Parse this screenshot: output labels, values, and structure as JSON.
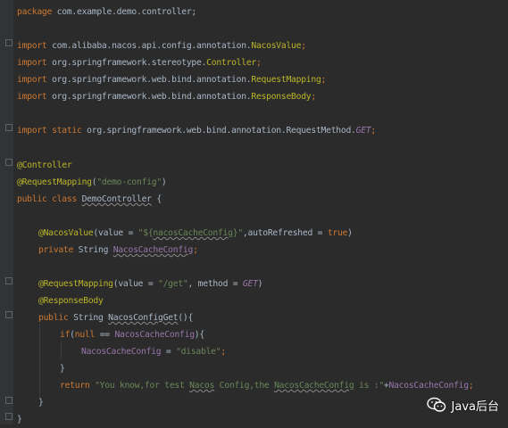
{
  "code": {
    "package_line": {
      "keyword": "package",
      "name": "com.example.demo.controller;"
    },
    "imports": [
      {
        "keyword": "import",
        "path": "com.alibaba.nacos.api.config.annotation.",
        "cls": "NacosValue",
        "end": ";"
      },
      {
        "keyword": "import",
        "path": "org.springframework.stereotype.",
        "cls": "Controller",
        "end": ";"
      },
      {
        "keyword": "import",
        "path": "org.springframework.web.bind.annotation.",
        "cls": "RequestMapping",
        "end": ";"
      },
      {
        "keyword": "import",
        "path": "org.springframework.web.bind.annotation.",
        "cls": "ResponseBody",
        "end": ";"
      }
    ],
    "static_import": {
      "keyword": "import static",
      "path": "org.springframework.web.bind.annotation.RequestMethod.",
      "cls": "GET",
      "end": ";"
    },
    "class_controller_annotation": "@Controller",
    "class_mapping": {
      "annotation": "@RequestMapping",
      "open": "(",
      "value": "\"demo-config\"",
      "close": ")"
    },
    "class_decl": {
      "keywords": "public class",
      "name": "DemoController",
      "brace": " {"
    },
    "field_annotation": {
      "annotation": "@NacosValue",
      "part1": "(value = ",
      "value_prefix": "\"${",
      "value_key": "nacosCacheConfig",
      "value_suffix": "}\"",
      "part2": ",autoRefreshed = ",
      "bool": "true",
      "part3": ")"
    },
    "field_decl": {
      "keyword": "private",
      "type": " String ",
      "name": "NacosCacheConfig",
      "end": ";"
    },
    "method_mapping": {
      "annotation": "@RequestMapping",
      "part1": "(value = ",
      "value": "\"/get\"",
      "part2": ", method = ",
      "method": "GET",
      "part3": ")"
    },
    "method_response_body": "@ResponseBody",
    "method_decl": {
      "keyword": "public",
      "type": " String ",
      "name": "NacosConfigGet",
      "rest": "(){"
    },
    "if_line": {
      "keyword": "if",
      "open": "(",
      "null_kw": "null",
      "op": " == ",
      "field": "NacosCacheConfig",
      "close": "){"
    },
    "assign_line": {
      "field": "NacosCacheConfig",
      "op": " = ",
      "value": "\"disable\"",
      "end": ";"
    },
    "if_close": "}",
    "return_line": {
      "keyword": "return",
      "str_a": " \"You know,for test ",
      "str_b": "Nacos",
      "str_c": " Config,the ",
      "str_d": "NacosCacheConfig",
      "str_e": " is :\"",
      "plus": "+",
      "field": "NacosCacheConfig",
      "end": ";"
    },
    "method_close": "}",
    "class_close": "}"
  },
  "watermark": {
    "icon": "wechat-icon",
    "text": "Java后台"
  },
  "colors": {
    "background": "#2b2b2b",
    "keyword": "#cc7832",
    "annotation": "#bbb529",
    "string": "#6a8759",
    "field": "#9876aa",
    "default": "#a9b7c6"
  }
}
